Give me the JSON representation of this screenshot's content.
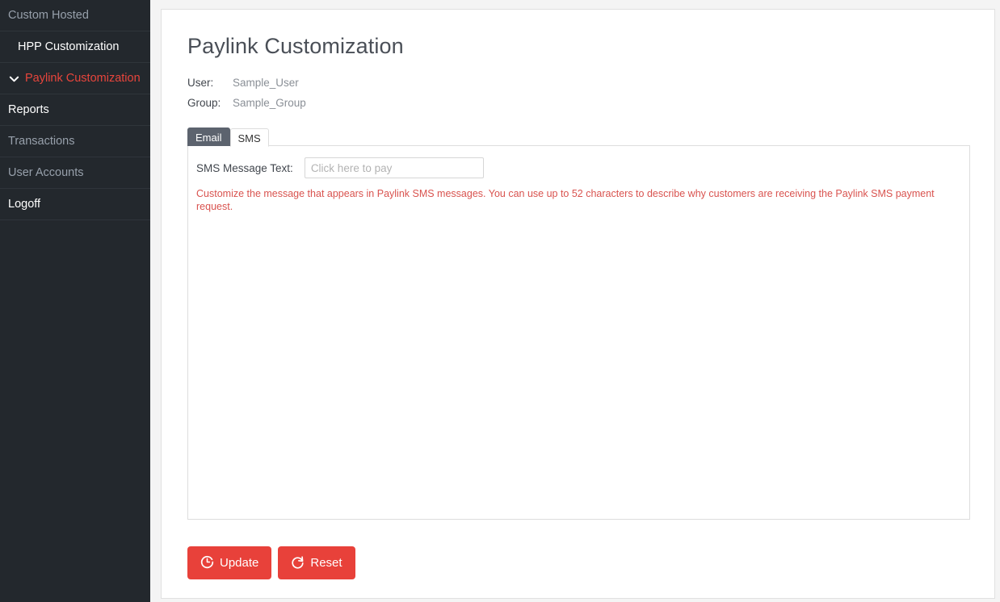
{
  "sidebar": {
    "items": [
      {
        "label": "Custom Hosted",
        "style": "muted",
        "icon": null
      },
      {
        "label": "HPP Customization",
        "style": "sub",
        "icon": null
      },
      {
        "label": "Paylink Customization",
        "style": "active",
        "icon": "chevron-down-icon"
      },
      {
        "label": "Reports",
        "style": "bright",
        "icon": null
      },
      {
        "label": "Transactions",
        "style": "muted",
        "icon": null
      },
      {
        "label": "User Accounts",
        "style": "muted",
        "icon": null
      },
      {
        "label": "Logoff",
        "style": "bright",
        "icon": null
      }
    ]
  },
  "main": {
    "title": "Paylink Customization",
    "user_label": "User:",
    "user_value": "Sample_User",
    "group_label": "Group:",
    "group_value": "Sample_Group",
    "tabs": [
      {
        "label": "Email",
        "active": false
      },
      {
        "label": "SMS",
        "active": true
      }
    ],
    "form": {
      "sms_message_label": "SMS Message Text:",
      "sms_message_value": "",
      "sms_message_placeholder": "Click here to pay",
      "helper_text": "Customize the message that appears in Paylink SMS messages. You can use up to 52 characters to describe why customers are receiving the Paylink SMS payment request."
    },
    "buttons": {
      "update_label": "Update",
      "update_icon": "refresh-clock-icon",
      "reset_label": "Reset",
      "reset_icon": "refresh-arrow-icon"
    }
  },
  "colors": {
    "accent_red": "#e8413a",
    "helper_red": "#d9534f",
    "sidebar_bg": "#23282d",
    "tab_inactive_bg": "#5c636e",
    "page_bg": "#f4f4f4"
  }
}
